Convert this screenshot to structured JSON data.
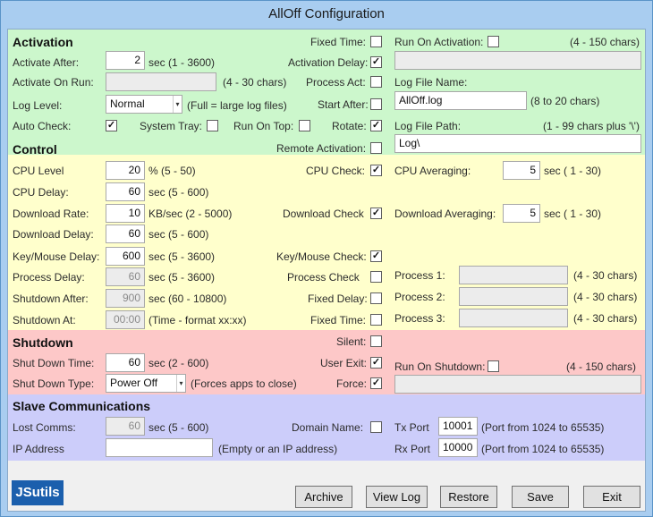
{
  "window": {
    "title": "AllOff Configuration"
  },
  "activation": {
    "heading": "Activation",
    "activate_after": {
      "label": "Activate After:",
      "value": "2",
      "hint": "sec (1 - 3600)"
    },
    "activate_on_run": {
      "label": "Activate On Run:",
      "value": "",
      "hint": "(4 - 30 chars)"
    },
    "log_level": {
      "label": "Log Level:",
      "value": "Normal",
      "hint": "(Full = large log files)"
    },
    "auto_check": {
      "label": "Auto Check:",
      "checked": true
    },
    "system_tray": {
      "label": "System Tray:",
      "checked": false
    },
    "run_on_top": {
      "label": "Run On Top:",
      "checked": false
    },
    "fixed_time": {
      "label": "Fixed Time:",
      "checked": false
    },
    "activation_delay": {
      "label": "Activation Delay:",
      "checked": true
    },
    "process_act": {
      "label": "Process Act:",
      "checked": false
    },
    "start_after": {
      "label": "Start After:",
      "checked": false
    },
    "rotate": {
      "label": "Rotate:",
      "checked": true
    },
    "remote_activation": {
      "label": "Remote Activation:",
      "checked": false
    },
    "run_on_activation": {
      "label": "Run On Activation:",
      "checked": false,
      "hint": "(4 - 150 chars)",
      "value": ""
    },
    "log_file_name": {
      "label": "Log File Name:",
      "value": "AllOff.log",
      "hint": "(8 to 20 chars)"
    },
    "log_file_path": {
      "label": "Log File Path:",
      "value": "Log\\",
      "hint": "(1 - 99 chars plus '\\')"
    }
  },
  "control": {
    "heading": "Control",
    "cpu_level": {
      "label": "CPU Level",
      "value": "20",
      "hint": "% (5 - 50)"
    },
    "cpu_delay": {
      "label": "CPU Delay:",
      "value": "60",
      "hint": "sec (5 - 600)"
    },
    "download_rate": {
      "label": "Download Rate:",
      "value": "10",
      "hint": "KB/sec (2 - 5000)"
    },
    "download_delay": {
      "label": "Download Delay:",
      "value": "60",
      "hint": "sec (5 - 600)"
    },
    "key_mouse_delay": {
      "label": "Key/Mouse Delay:",
      "value": "600",
      "hint": "sec (5 - 3600)"
    },
    "process_delay": {
      "label": "Process Delay:",
      "value": "60",
      "hint": "sec (5 - 3600)"
    },
    "shutdown_after": {
      "label": "Shutdown After:",
      "value": "900",
      "hint": "sec (60 - 10800)"
    },
    "shutdown_at": {
      "label": "Shutdown At:",
      "value": "00:00",
      "hint": "(Time - format xx:xx)"
    },
    "cpu_check": {
      "label": "CPU Check:",
      "checked": true
    },
    "download_check": {
      "label": "Download Check",
      "checked": true
    },
    "key_mouse_check": {
      "label": "Key/Mouse Check:",
      "checked": true
    },
    "process_check": {
      "label": "Process Check",
      "checked": false
    },
    "fixed_delay": {
      "label": "Fixed Delay:",
      "checked": false
    },
    "fixed_time": {
      "label": "Fixed Time:",
      "checked": false
    },
    "cpu_averaging": {
      "label": "CPU Averaging:",
      "value": "5",
      "hint": "sec ( 1 - 30)"
    },
    "download_averaging": {
      "label": "Download Averaging:",
      "value": "5",
      "hint": "sec ( 1 - 30)"
    },
    "process1": {
      "label": "Process 1:",
      "value": "",
      "hint": "(4 - 30 chars)"
    },
    "process2": {
      "label": "Process 2:",
      "value": "",
      "hint": "(4 - 30 chars)"
    },
    "process3": {
      "label": "Process 3:",
      "value": "",
      "hint": "(4 - 30 chars)"
    }
  },
  "shutdown": {
    "heading": "Shutdown",
    "shut_down_time": {
      "label": "Shut Down Time:",
      "value": "60",
      "hint": "sec (2 - 600)"
    },
    "shut_down_type": {
      "label": "Shut Down Type:",
      "value": "Power Off",
      "hint": "(Forces apps to close)"
    },
    "silent": {
      "label": "Silent:",
      "checked": false
    },
    "user_exit": {
      "label": "User Exit:",
      "checked": true
    },
    "force": {
      "label": "Force:",
      "checked": true
    },
    "run_on_shutdown": {
      "label": "Run On Shutdown:",
      "checked": false,
      "hint": "(4 - 150 chars)",
      "value": ""
    }
  },
  "slave": {
    "heading": "Slave Communications",
    "lost_comms": {
      "label": "Lost Comms:",
      "value": "60",
      "hint": "sec (5 - 600)"
    },
    "ip_address": {
      "label": "IP Address",
      "value": "",
      "hint": "(Empty or an IP address)"
    },
    "domain_name": {
      "label": "Domain Name:",
      "checked": false
    },
    "tx_port": {
      "label": "Tx Port",
      "value": "10001",
      "hint": "(Port from 1024 to 65535)"
    },
    "rx_port": {
      "label": "Rx Port",
      "value": "10000",
      "hint": "(Port from 1024 to 65535)"
    }
  },
  "footer": {
    "logo": "JSutils",
    "archive": "Archive",
    "view_log": "View Log",
    "restore": "Restore",
    "save": "Save",
    "exit": "Exit"
  }
}
